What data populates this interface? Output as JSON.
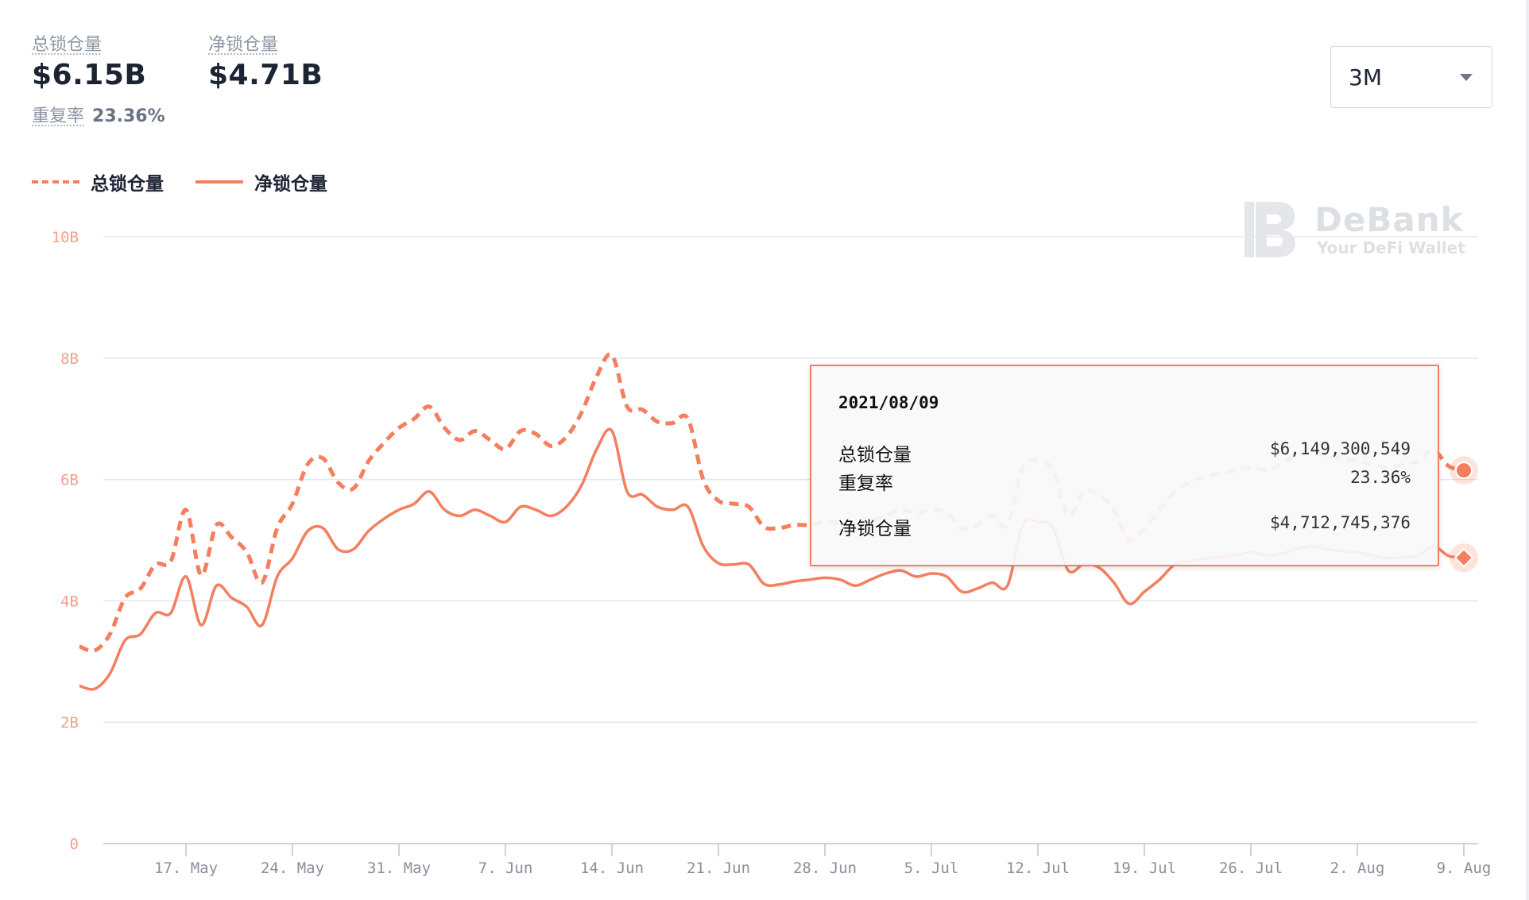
{
  "stats": {
    "total": {
      "label": "总锁仓量",
      "value": "$6.15B"
    },
    "net": {
      "label": "净锁仓量",
      "value": "$4.71B"
    },
    "ratio": {
      "label": "重复率",
      "value": "23.36%"
    }
  },
  "range_select": {
    "value": "3M"
  },
  "legend": {
    "total": "总锁仓量",
    "net": "净锁仓量"
  },
  "watermark": {
    "brand": "DeBank",
    "tagline": "Your DeFi Wallet"
  },
  "colors": {
    "accent": "#f47f5f",
    "grid": "#e3e6ea",
    "axis_label": "#f4a08a",
    "x_label": "#8a8f99"
  },
  "tooltip": {
    "date": "2021/08/09",
    "rows": [
      {
        "label": "总锁仓量",
        "value": "$6,149,300,549"
      },
      {
        "label": "重复率",
        "value": "23.36%"
      },
      {
        "label": "净锁仓量",
        "value": "$4,712,745,376"
      }
    ]
  },
  "chart_data": {
    "type": "line",
    "x_unit": "day",
    "x_range": [
      "2021-05-10",
      "2021-08-09"
    ],
    "y_ticks": [
      {
        "v": 0,
        "label": "0"
      },
      {
        "v": 2,
        "label": "2B"
      },
      {
        "v": 4,
        "label": "4B"
      },
      {
        "v": 6,
        "label": "6B"
      },
      {
        "v": 8,
        "label": "8B"
      },
      {
        "v": 10,
        "label": "10B"
      }
    ],
    "ylim": [
      0,
      10
    ],
    "x_ticks": [
      {
        "date": "2021-05-17",
        "label": "17. May"
      },
      {
        "date": "2021-05-24",
        "label": "24. May"
      },
      {
        "date": "2021-05-31",
        "label": "31. May"
      },
      {
        "date": "2021-06-07",
        "label": "7. Jun"
      },
      {
        "date": "2021-06-14",
        "label": "14. Jun"
      },
      {
        "date": "2021-06-21",
        "label": "21. Jun"
      },
      {
        "date": "2021-06-28",
        "label": "28. Jun"
      },
      {
        "date": "2021-07-05",
        "label": "5. Jul"
      },
      {
        "date": "2021-07-12",
        "label": "12. Jul"
      },
      {
        "date": "2021-07-19",
        "label": "19. Jul"
      },
      {
        "date": "2021-07-26",
        "label": "26. Jul"
      },
      {
        "date": "2021-08-02",
        "label": "2. Aug"
      },
      {
        "date": "2021-08-09",
        "label": "9. Aug"
      }
    ],
    "series": [
      {
        "name": "总锁仓量",
        "style": "dashed",
        "points": [
          [
            "2021-05-10",
            3.25
          ],
          [
            "2021-05-11",
            3.18
          ],
          [
            "2021-05-12",
            3.45
          ],
          [
            "2021-05-13",
            4.05
          ],
          [
            "2021-05-14",
            4.2
          ],
          [
            "2021-05-15",
            4.6
          ],
          [
            "2021-05-16",
            4.65
          ],
          [
            "2021-05-17",
            5.5
          ],
          [
            "2021-05-18",
            4.42
          ],
          [
            "2021-05-19",
            5.25
          ],
          [
            "2021-05-20",
            5.05
          ],
          [
            "2021-05-21",
            4.8
          ],
          [
            "2021-05-22",
            4.3
          ],
          [
            "2021-05-23",
            5.2
          ],
          [
            "2021-05-24",
            5.6
          ],
          [
            "2021-05-25",
            6.25
          ],
          [
            "2021-05-26",
            6.35
          ],
          [
            "2021-05-27",
            5.95
          ],
          [
            "2021-05-28",
            5.85
          ],
          [
            "2021-05-29",
            6.3
          ],
          [
            "2021-05-30",
            6.6
          ],
          [
            "2021-05-31",
            6.85
          ],
          [
            "2021-06-01",
            7.0
          ],
          [
            "2021-06-02",
            7.2
          ],
          [
            "2021-06-03",
            6.85
          ],
          [
            "2021-06-04",
            6.65
          ],
          [
            "2021-06-05",
            6.8
          ],
          [
            "2021-06-06",
            6.65
          ],
          [
            "2021-06-07",
            6.5
          ],
          [
            "2021-06-08",
            6.8
          ],
          [
            "2021-06-09",
            6.75
          ],
          [
            "2021-06-10",
            6.55
          ],
          [
            "2021-06-11",
            6.7
          ],
          [
            "2021-06-12",
            7.1
          ],
          [
            "2021-06-13",
            7.7
          ],
          [
            "2021-06-14",
            8.05
          ],
          [
            "2021-06-15",
            7.2
          ],
          [
            "2021-06-16",
            7.15
          ],
          [
            "2021-06-17",
            6.95
          ],
          [
            "2021-06-18",
            6.93
          ],
          [
            "2021-06-19",
            7.0
          ],
          [
            "2021-06-20",
            6.0
          ],
          [
            "2021-06-21",
            5.65
          ],
          [
            "2021-06-22",
            5.6
          ],
          [
            "2021-06-23",
            5.55
          ],
          [
            "2021-06-24",
            5.22
          ],
          [
            "2021-06-25",
            5.2
          ],
          [
            "2021-06-26",
            5.25
          ],
          [
            "2021-06-27",
            5.25
          ],
          [
            "2021-06-28",
            5.3
          ],
          [
            "2021-06-29",
            5.28
          ],
          [
            "2021-06-30",
            5.18
          ],
          [
            "2021-07-01",
            5.3
          ],
          [
            "2021-07-02",
            5.4
          ],
          [
            "2021-07-03",
            5.5
          ],
          [
            "2021-07-04",
            5.45
          ],
          [
            "2021-07-05",
            5.5
          ],
          [
            "2021-07-06",
            5.45
          ],
          [
            "2021-07-07",
            5.2
          ],
          [
            "2021-07-08",
            5.25
          ],
          [
            "2021-07-09",
            5.4
          ],
          [
            "2021-07-10",
            5.25
          ],
          [
            "2021-07-11",
            6.2
          ],
          [
            "2021-07-12",
            6.3
          ],
          [
            "2021-07-13",
            6.15
          ],
          [
            "2021-07-14",
            5.4
          ],
          [
            "2021-07-15",
            5.8
          ],
          [
            "2021-07-16",
            5.75
          ],
          [
            "2021-07-17",
            5.5
          ],
          [
            "2021-07-18",
            5.0
          ],
          [
            "2021-07-19",
            5.2
          ],
          [
            "2021-07-20",
            5.5
          ],
          [
            "2021-07-21",
            5.8
          ],
          [
            "2021-07-22",
            5.95
          ],
          [
            "2021-07-23",
            6.05
          ],
          [
            "2021-07-24",
            6.1
          ],
          [
            "2021-07-25",
            6.15
          ],
          [
            "2021-07-26",
            6.2
          ],
          [
            "2021-07-27",
            6.15
          ],
          [
            "2021-07-28",
            6.25
          ],
          [
            "2021-07-29",
            6.4
          ],
          [
            "2021-07-30",
            6.45
          ],
          [
            "2021-07-31",
            6.38
          ],
          [
            "2021-08-01",
            6.35
          ],
          [
            "2021-08-02",
            6.3
          ],
          [
            "2021-08-03",
            6.25
          ],
          [
            "2021-08-04",
            6.2
          ],
          [
            "2021-08-05",
            6.25
          ],
          [
            "2021-08-06",
            6.3
          ],
          [
            "2021-08-07",
            6.48
          ],
          [
            "2021-08-08",
            6.22
          ],
          [
            "2021-08-09",
            6.15
          ]
        ]
      },
      {
        "name": "净锁仓量",
        "style": "solid",
        "points": [
          [
            "2021-05-10",
            2.6
          ],
          [
            "2021-05-11",
            2.55
          ],
          [
            "2021-05-12",
            2.8
          ],
          [
            "2021-05-13",
            3.35
          ],
          [
            "2021-05-14",
            3.45
          ],
          [
            "2021-05-15",
            3.8
          ],
          [
            "2021-05-16",
            3.8
          ],
          [
            "2021-05-17",
            4.4
          ],
          [
            "2021-05-18",
            3.6
          ],
          [
            "2021-05-19",
            4.25
          ],
          [
            "2021-05-20",
            4.05
          ],
          [
            "2021-05-21",
            3.9
          ],
          [
            "2021-05-22",
            3.6
          ],
          [
            "2021-05-23",
            4.4
          ],
          [
            "2021-05-24",
            4.7
          ],
          [
            "2021-05-25",
            5.15
          ],
          [
            "2021-05-26",
            5.2
          ],
          [
            "2021-05-27",
            4.85
          ],
          [
            "2021-05-28",
            4.85
          ],
          [
            "2021-05-29",
            5.15
          ],
          [
            "2021-05-30",
            5.35
          ],
          [
            "2021-05-31",
            5.5
          ],
          [
            "2021-06-01",
            5.6
          ],
          [
            "2021-06-02",
            5.8
          ],
          [
            "2021-06-03",
            5.5
          ],
          [
            "2021-06-04",
            5.4
          ],
          [
            "2021-06-05",
            5.5
          ],
          [
            "2021-06-06",
            5.4
          ],
          [
            "2021-06-07",
            5.3
          ],
          [
            "2021-06-08",
            5.55
          ],
          [
            "2021-06-09",
            5.5
          ],
          [
            "2021-06-10",
            5.4
          ],
          [
            "2021-06-11",
            5.55
          ],
          [
            "2021-06-12",
            5.9
          ],
          [
            "2021-06-13",
            6.5
          ],
          [
            "2021-06-14",
            6.8
          ],
          [
            "2021-06-15",
            5.8
          ],
          [
            "2021-06-16",
            5.75
          ],
          [
            "2021-06-17",
            5.55
          ],
          [
            "2021-06-18",
            5.5
          ],
          [
            "2021-06-19",
            5.55
          ],
          [
            "2021-06-20",
            4.9
          ],
          [
            "2021-06-21",
            4.62
          ],
          [
            "2021-06-22",
            4.6
          ],
          [
            "2021-06-23",
            4.6
          ],
          [
            "2021-06-24",
            4.28
          ],
          [
            "2021-06-25",
            4.27
          ],
          [
            "2021-06-26",
            4.32
          ],
          [
            "2021-06-27",
            4.35
          ],
          [
            "2021-06-28",
            4.38
          ],
          [
            "2021-06-29",
            4.35
          ],
          [
            "2021-06-30",
            4.25
          ],
          [
            "2021-07-01",
            4.35
          ],
          [
            "2021-07-02",
            4.45
          ],
          [
            "2021-07-03",
            4.5
          ],
          [
            "2021-07-04",
            4.4
          ],
          [
            "2021-07-05",
            4.45
          ],
          [
            "2021-07-06",
            4.4
          ],
          [
            "2021-07-07",
            4.15
          ],
          [
            "2021-07-08",
            4.2
          ],
          [
            "2021-07-09",
            4.3
          ],
          [
            "2021-07-10",
            4.25
          ],
          [
            "2021-07-11",
            5.25
          ],
          [
            "2021-07-12",
            5.3
          ],
          [
            "2021-07-13",
            5.2
          ],
          [
            "2021-07-14",
            4.5
          ],
          [
            "2021-07-15",
            4.6
          ],
          [
            "2021-07-16",
            4.55
          ],
          [
            "2021-07-17",
            4.3
          ],
          [
            "2021-07-18",
            3.95
          ],
          [
            "2021-07-19",
            4.15
          ],
          [
            "2021-07-20",
            4.35
          ],
          [
            "2021-07-21",
            4.6
          ],
          [
            "2021-07-22",
            4.65
          ],
          [
            "2021-07-23",
            4.7
          ],
          [
            "2021-07-24",
            4.72
          ],
          [
            "2021-07-25",
            4.75
          ],
          [
            "2021-07-26",
            4.8
          ],
          [
            "2021-07-27",
            4.75
          ],
          [
            "2021-07-28",
            4.78
          ],
          [
            "2021-07-29",
            4.85
          ],
          [
            "2021-07-30",
            4.9
          ],
          [
            "2021-07-31",
            4.85
          ],
          [
            "2021-08-01",
            4.82
          ],
          [
            "2021-08-02",
            4.8
          ],
          [
            "2021-08-03",
            4.75
          ],
          [
            "2021-08-04",
            4.7
          ],
          [
            "2021-08-05",
            4.72
          ],
          [
            "2021-08-06",
            4.75
          ],
          [
            "2021-08-07",
            4.9
          ],
          [
            "2021-08-08",
            4.74
          ],
          [
            "2021-08-09",
            4.71
          ]
        ]
      }
    ]
  }
}
